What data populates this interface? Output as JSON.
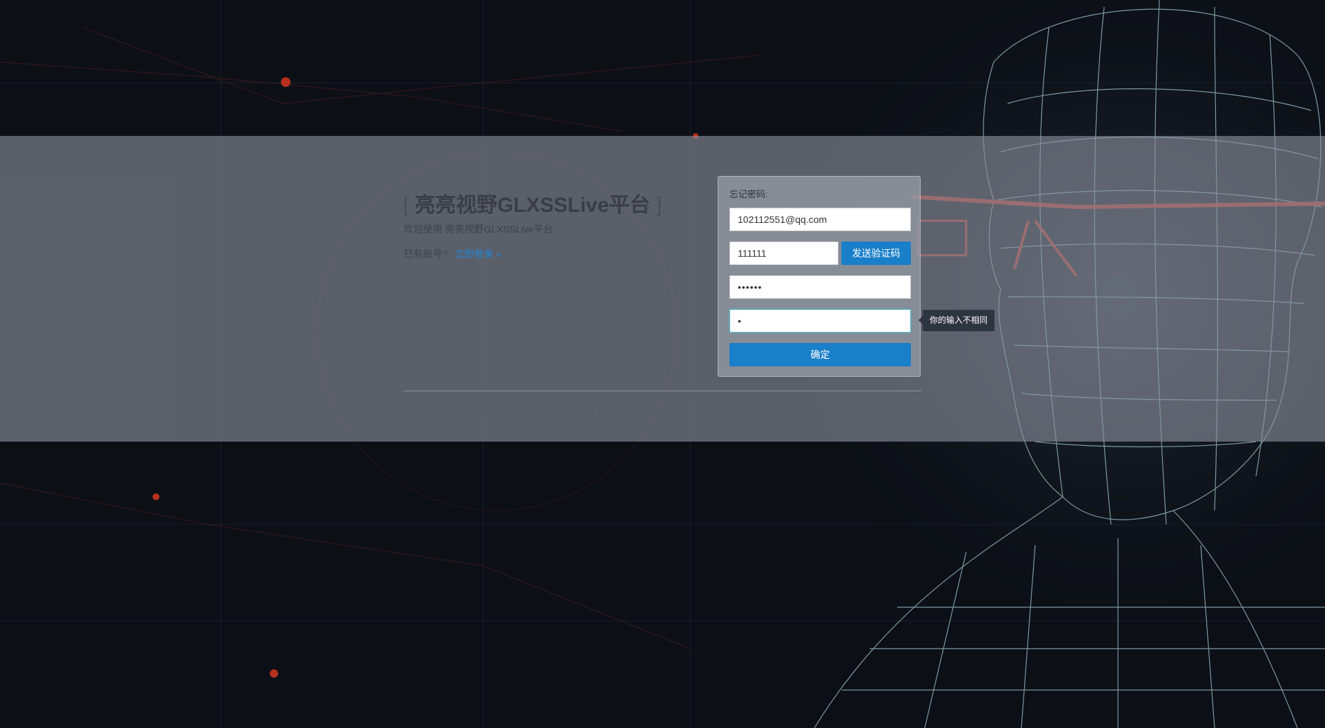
{
  "brand": {
    "bracket_open": "[",
    "title": "亮亮视野GLXSSLive平台",
    "bracket_close": "]",
    "welcome": "欢迎使用 亮亮视野GLXSSLive平台",
    "account_prompt": "已有账号?",
    "login_link": "立即登录 »"
  },
  "form": {
    "title": "忘记密码:",
    "email_value": "102112551@qq.com",
    "code_value": "111111",
    "send_code_label": "发送验证码",
    "password_value": "111111",
    "confirm_value": "1",
    "submit_label": "确定",
    "tooltip": "你的输入不相同"
  },
  "footer": {
    "copyright": "Copyright © 2017 亮亮视野 All Rights Reserved"
  },
  "colors": {
    "accent": "#1a7fc9",
    "background": "#0c0f16",
    "band": "#8c929e"
  }
}
